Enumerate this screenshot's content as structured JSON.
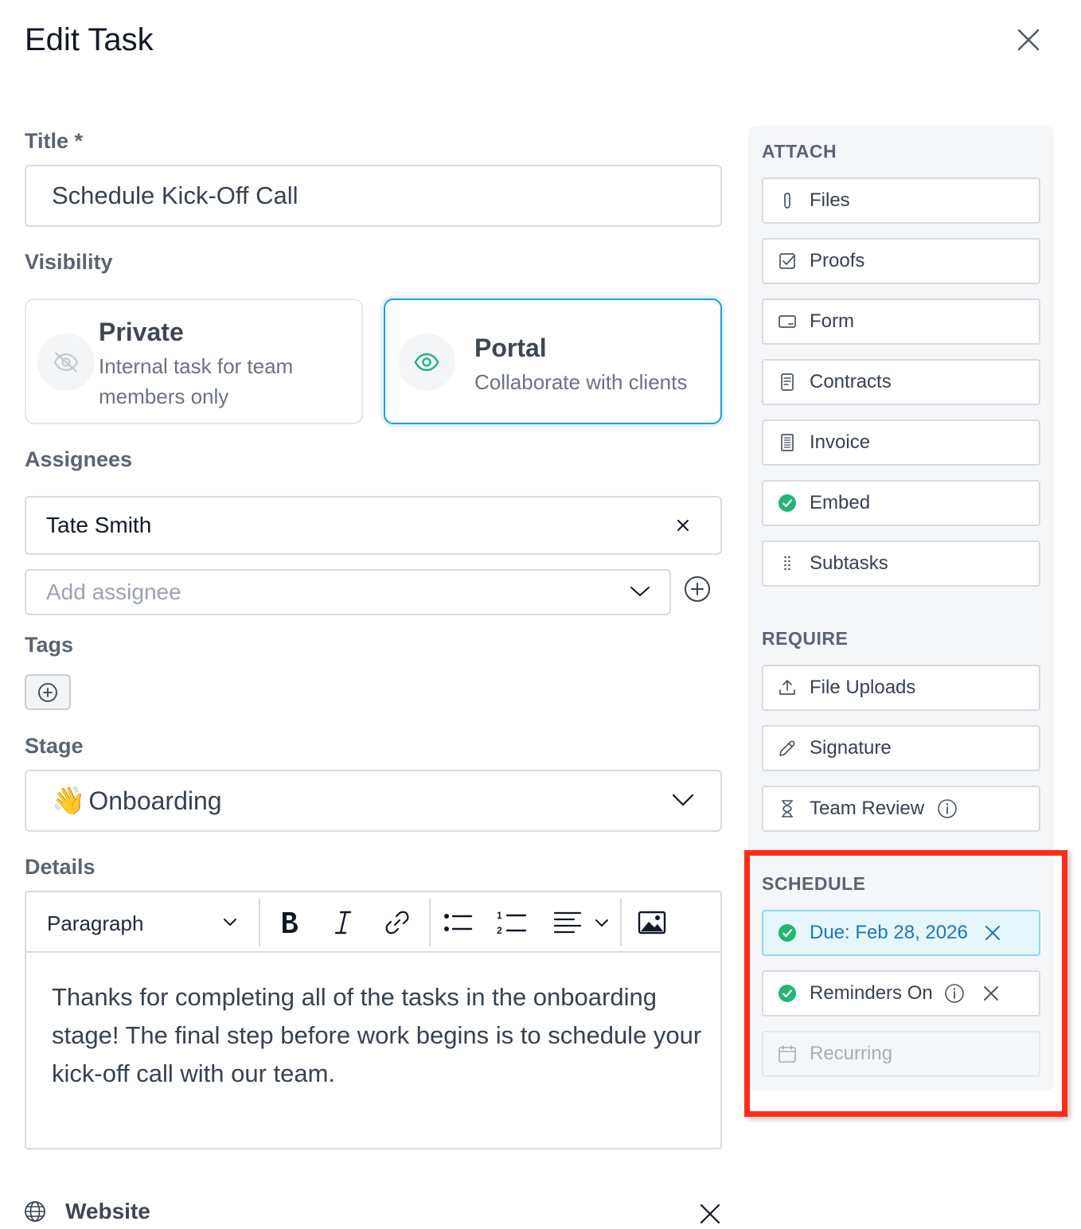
{
  "header": {
    "title": "Edit Task"
  },
  "title_field": {
    "label": "Title *",
    "value": "Schedule Kick-Off Call"
  },
  "visibility": {
    "label": "Visibility",
    "options": [
      {
        "title": "Private",
        "desc_line1": "Internal task for team",
        "desc_line2": "members only",
        "icon": "eye-off-icon",
        "selected": false
      },
      {
        "title": "Portal",
        "desc": "Collaborate with clients",
        "icon": "eye-icon",
        "selected": true
      }
    ]
  },
  "assignees": {
    "label": "Assignees",
    "selected": "Tate Smith",
    "add_placeholder": "Add assignee"
  },
  "tags": {
    "label": "Tags"
  },
  "stage": {
    "label": "Stage",
    "emoji": "👋",
    "value": "Onboarding"
  },
  "details": {
    "label": "Details",
    "block_format": "Paragraph",
    "body": "Thanks for completing all of the tasks in the onboarding stage! The final step before work begins is to schedule your kick-off call with our team."
  },
  "website": {
    "label": "Website"
  },
  "sidebar": {
    "attach": {
      "heading": "ATTACH",
      "items": [
        {
          "label": "Files",
          "icon": "paperclip-icon"
        },
        {
          "label": "Proofs",
          "icon": "checkbox-icon"
        },
        {
          "label": "Form",
          "icon": "form-icon"
        },
        {
          "label": "Contracts",
          "icon": "document-icon"
        },
        {
          "label": "Invoice",
          "icon": "invoice-icon"
        },
        {
          "label": "Embed",
          "icon": "check-circle-icon"
        },
        {
          "label": "Subtasks",
          "icon": "drag-handle-icon"
        }
      ]
    },
    "require": {
      "heading": "REQUIRE",
      "items": [
        {
          "label": "File Uploads",
          "icon": "upload-icon"
        },
        {
          "label": "Signature",
          "icon": "pen-icon"
        },
        {
          "label": "Team Review",
          "icon": "hourglass-icon"
        }
      ]
    },
    "schedule": {
      "heading": "SCHEDULE",
      "items": [
        {
          "label": "Due: Feb 28, 2026",
          "icon": "check-circle-icon"
        },
        {
          "label": "Reminders On",
          "icon": "check-circle-icon"
        },
        {
          "label": "Recurring",
          "icon": "calendar-icon"
        }
      ]
    }
  },
  "colors": {
    "accent": "#1aa1d6",
    "success": "#22b573",
    "highlight": "#ff2b1c",
    "due_text": "#1a78b8"
  }
}
